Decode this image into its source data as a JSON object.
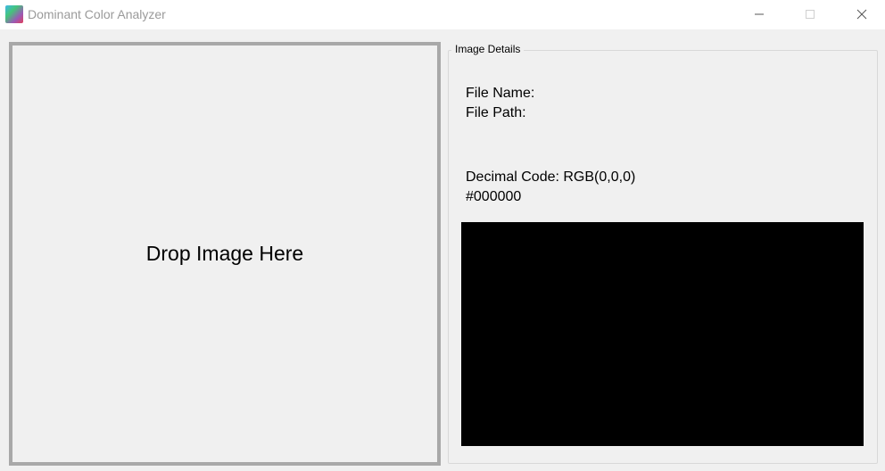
{
  "window": {
    "title": "Dominant Color Analyzer",
    "icon": "color-gradient-app-icon"
  },
  "drop_zone": {
    "label": "Drop Image Here"
  },
  "details": {
    "group_title": "Image Details",
    "file_name_label": "File Name:",
    "file_path_label": "File Path:",
    "decimal_code": "Decimal Code: RGB(0,0,0)",
    "hex_code": "#000000",
    "swatch_color": "#000000"
  }
}
